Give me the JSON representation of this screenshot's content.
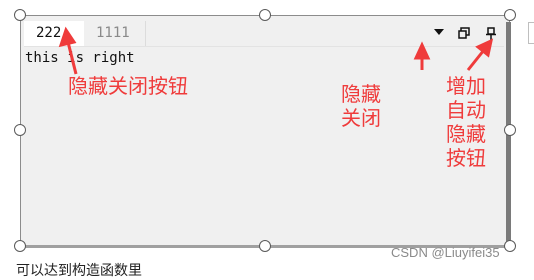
{
  "tabs": [
    {
      "label": "222",
      "active": true
    },
    {
      "label": "1111",
      "active": false
    }
  ],
  "document": {
    "text": "this is right"
  },
  "toolbar": {
    "icons": [
      "dropdown-arrow-icon",
      "float-window-icon",
      "pin-icon"
    ]
  },
  "annotations": {
    "hide_close_button": "隐藏关闭按钮",
    "hide_close": "隐藏\n关闭",
    "add_auto_hide_button": "增加\n自动\n隐藏\n按钮"
  },
  "watermark": "CSDN @Liuyifei35",
  "bottom_text": "可以达到构造函数里",
  "colors": {
    "annotation": "#ef3b3b",
    "panel": "#f0f0f0",
    "border": "#8c8c8c"
  }
}
